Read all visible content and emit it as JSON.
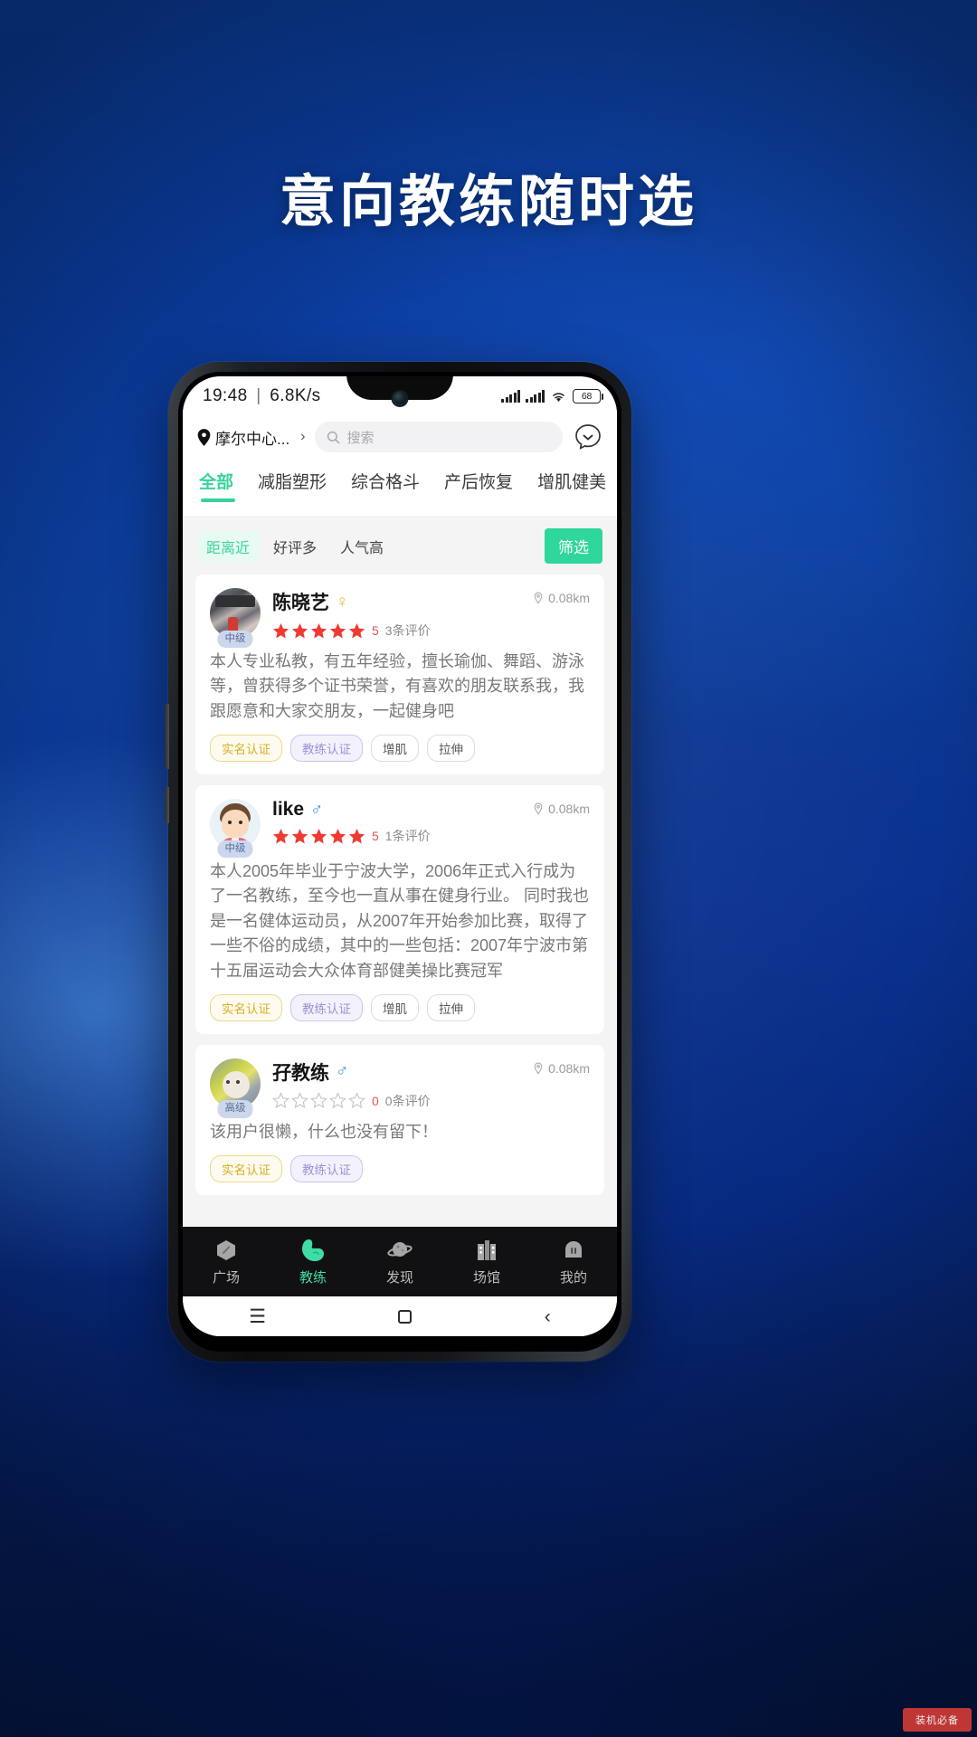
{
  "poster": {
    "headline": "意向教练随时选",
    "watermark": "装机必备"
  },
  "status_bar": {
    "time": "19:48",
    "separator": "|",
    "net_speed": "6.8K/s",
    "battery_level": "68",
    "icons": [
      "signal-icon",
      "signal-icon",
      "wifi-icon",
      "battery-icon"
    ]
  },
  "topbar": {
    "location": "摩尔中心...",
    "location_icon": "map-pin-icon",
    "chevron": "›",
    "search_icon": "search-icon",
    "search_placeholder": "搜索",
    "search_value": "",
    "chat_icon": "chat-bubble-icon"
  },
  "categories": [
    {
      "label": "全部",
      "active": true
    },
    {
      "label": "减脂塑形",
      "active": false
    },
    {
      "label": "综合格斗",
      "active": false
    },
    {
      "label": "产后恢复",
      "active": false
    },
    {
      "label": "增肌健美",
      "active": false
    }
  ],
  "sort": {
    "chips": [
      {
        "label": "距离近",
        "active": true
      },
      {
        "label": "好评多",
        "active": false
      },
      {
        "label": "人气高",
        "active": false
      }
    ],
    "filter_label": "筛选"
  },
  "coaches": [
    {
      "name": "陈晓艺",
      "gender": "♀",
      "gender_type": "f",
      "level": "中级",
      "distance": "0.08km",
      "rating": 5,
      "rating_text": "5",
      "reviews": "3条评价",
      "desc": "本人专业私教，有五年经验，擅长瑜伽、舞蹈、游泳等，曾获得多个证书荣誉，有喜欢的朋友联系我，我跟愿意和大家交朋友，一起健身吧",
      "tags": [
        "实名认证",
        "教练认证",
        "增肌",
        "拉伸"
      ]
    },
    {
      "name": "like",
      "gender": "♂",
      "gender_type": "m",
      "level": "中级",
      "distance": "0.08km",
      "rating": 5,
      "rating_text": "5",
      "reviews": "1条评价",
      "desc": "本人2005年毕业于宁波大学，2006年正式入行成为了一名教练，至今也一直从事在健身行业。 同时我也是一名健体运动员，从2007年开始参加比赛，取得了一些不俗的成绩，其中的一些包括：2007年宁波市第十五届运动会大众体育部健美操比赛冠军",
      "tags": [
        "实名认证",
        "教练认证",
        "增肌",
        "拉伸"
      ]
    },
    {
      "name": "孖教练",
      "gender": "♂",
      "gender_type": "m",
      "level": "高级",
      "distance": "0.08km",
      "rating": 0,
      "rating_text": "0",
      "reviews": "0条评价",
      "desc": "该用户很懒，什么也没有留下！",
      "tags": [
        "实名认证",
        "教练认证"
      ]
    }
  ],
  "tabbar": [
    {
      "label": "广场",
      "icon": "plaza-icon",
      "active": false
    },
    {
      "label": "教练",
      "icon": "muscle-arm-icon",
      "active": true
    },
    {
      "label": "发现",
      "icon": "planet-icon",
      "active": false
    },
    {
      "label": "场馆",
      "icon": "building-icon",
      "active": false
    },
    {
      "label": "我的",
      "icon": "profile-icon",
      "active": false
    }
  ],
  "android_nav": {
    "menu_icon": "menu-icon",
    "home_icon": "home-square-icon",
    "back_icon": "back-chevron-icon"
  },
  "colors": {
    "accent_green": "#2fd79c",
    "brand_blue": "#0b3fa0",
    "star_red": "#ee3b32"
  }
}
